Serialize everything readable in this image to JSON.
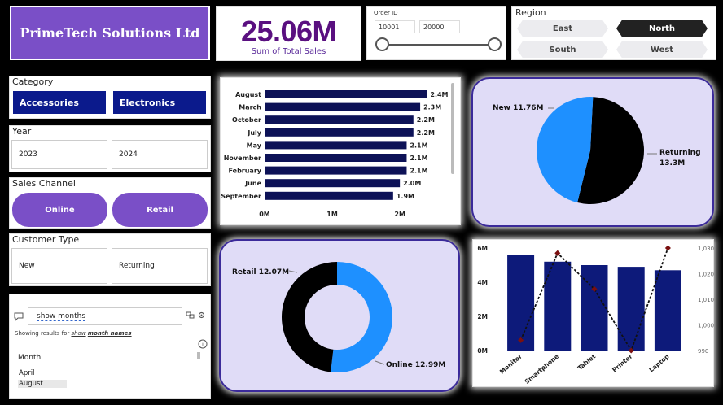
{
  "title": "PrimeTech Solutions Ltd",
  "kpi": {
    "value": "25.06M",
    "label": "Sum of Total Sales"
  },
  "order_id": {
    "label": "Order ID",
    "min": "10001",
    "max": "20000"
  },
  "region": {
    "label": "Region",
    "options": [
      "East",
      "North",
      "South",
      "West"
    ],
    "selected": "North"
  },
  "category": {
    "label": "Category",
    "options": [
      "Accessories",
      "Electronics"
    ]
  },
  "year": {
    "label": "Year",
    "options": [
      "2023",
      "2024"
    ]
  },
  "sales_channel": {
    "label": "Sales Channel",
    "options": [
      "Online",
      "Retail"
    ]
  },
  "customer_type": {
    "label": "Customer Type",
    "options": [
      "New",
      "Returning"
    ]
  },
  "qa": {
    "query": "show months",
    "note_prefix": "Showing results for ",
    "note_link": "show",
    "note_bold": "month names",
    "field": "Month",
    "rows": [
      "April",
      "August"
    ]
  },
  "icons": {
    "chat": "chat-bubble-icon",
    "format": "format-icon",
    "settings": "gear-icon",
    "info": "info-icon"
  },
  "colors": {
    "purple": "#7a4fc7",
    "navy": "#0b1a8c",
    "blue": "#1e90ff",
    "black": "#000000",
    "kpi": "#5a1080"
  },
  "chart_data": [
    {
      "type": "bar",
      "orientation": "horizontal",
      "categories": [
        "August",
        "March",
        "October",
        "July",
        "May",
        "November",
        "February",
        "June",
        "September"
      ],
      "values": [
        2.4,
        2.3,
        2.2,
        2.2,
        2.1,
        2.1,
        2.1,
        2.0,
        1.9
      ],
      "data_labels": [
        "2.4M",
        "2.3M",
        "2.2M",
        "2.2M",
        "2.1M",
        "2.1M",
        "2.1M",
        "2.0M",
        "1.9M"
      ],
      "x_ticks": [
        "0M",
        "1M",
        "2M"
      ],
      "xlim": [
        0,
        2.6
      ]
    },
    {
      "type": "pie",
      "labels": [
        "New",
        "Returning"
      ],
      "values": [
        11.76,
        13.3
      ],
      "data_labels": [
        "New 11.76M",
        "Returning 13.3M"
      ]
    },
    {
      "type": "pie",
      "donut": true,
      "labels": [
        "Retail",
        "Online"
      ],
      "values": [
        12.07,
        12.99
      ],
      "data_labels": [
        "Retail 12.07M",
        "Online 12.99M"
      ]
    },
    {
      "type": "bar",
      "combo": true,
      "categories": [
        "Monitor",
        "Smartphone",
        "Tablet",
        "Printer",
        "Laptop"
      ],
      "bar_values": [
        5.6,
        5.2,
        5.0,
        4.9,
        4.7
      ],
      "line_values": [
        994,
        1028,
        1014,
        990,
        1030
      ],
      "y_ticks": [
        "0M",
        "2M",
        "4M",
        "6M"
      ],
      "y2_ticks": [
        "990",
        "1,000",
        "1,010",
        "1,020",
        "1,030"
      ],
      "ylim": [
        0,
        6
      ],
      "y2lim": [
        990,
        1030
      ]
    }
  ]
}
